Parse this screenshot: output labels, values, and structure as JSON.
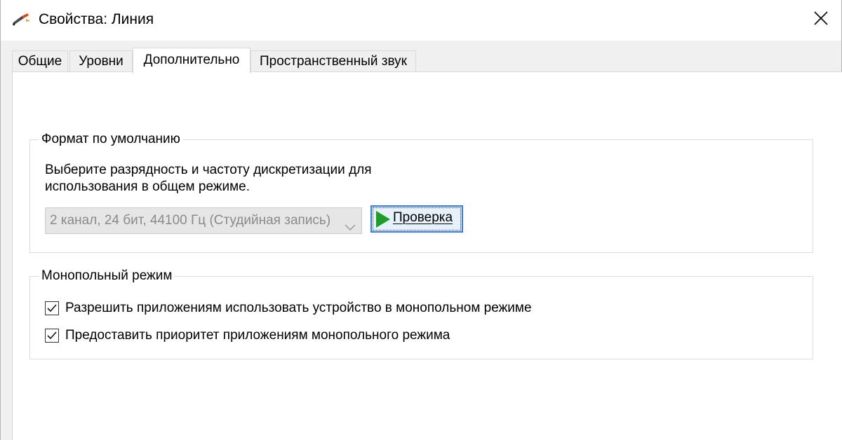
{
  "window": {
    "title": "Свойства: Линия"
  },
  "tabs": [
    {
      "label": "Общие"
    },
    {
      "label": "Уровни"
    },
    {
      "label": "Дополнительно"
    },
    {
      "label": "Пространственный звук"
    }
  ],
  "active_tab_index": 2,
  "default_format": {
    "legend": "Формат по умолчанию",
    "description_line1": "Выберите разрядность и частоту дискретизации для",
    "description_line2": "использования в общем режиме.",
    "format_select_value": "2 канал, 24 бит, 44100 Гц (Студийная запись)",
    "format_select_disabled": true,
    "test_button_label": "Проверка"
  },
  "exclusive_mode": {
    "legend": "Монопольный режим",
    "options": [
      {
        "label": "Разрешить приложениям использовать устройство в монопольном режиме",
        "checked": true
      },
      {
        "label": "Предоставить приоритет приложениям монопольного режима",
        "checked": true
      }
    ]
  },
  "icons": {
    "title": "speaker-line-icon",
    "close": "close-icon",
    "combo_arrow": "chevron-down-icon",
    "test": "play-icon",
    "check": "checkmark-icon"
  },
  "colors": {
    "accent_border": "#3a7bd5",
    "button_fill": "#e5f1fb",
    "play_green": "#1f9a2b",
    "disabled_text": "#8a8a8a"
  }
}
